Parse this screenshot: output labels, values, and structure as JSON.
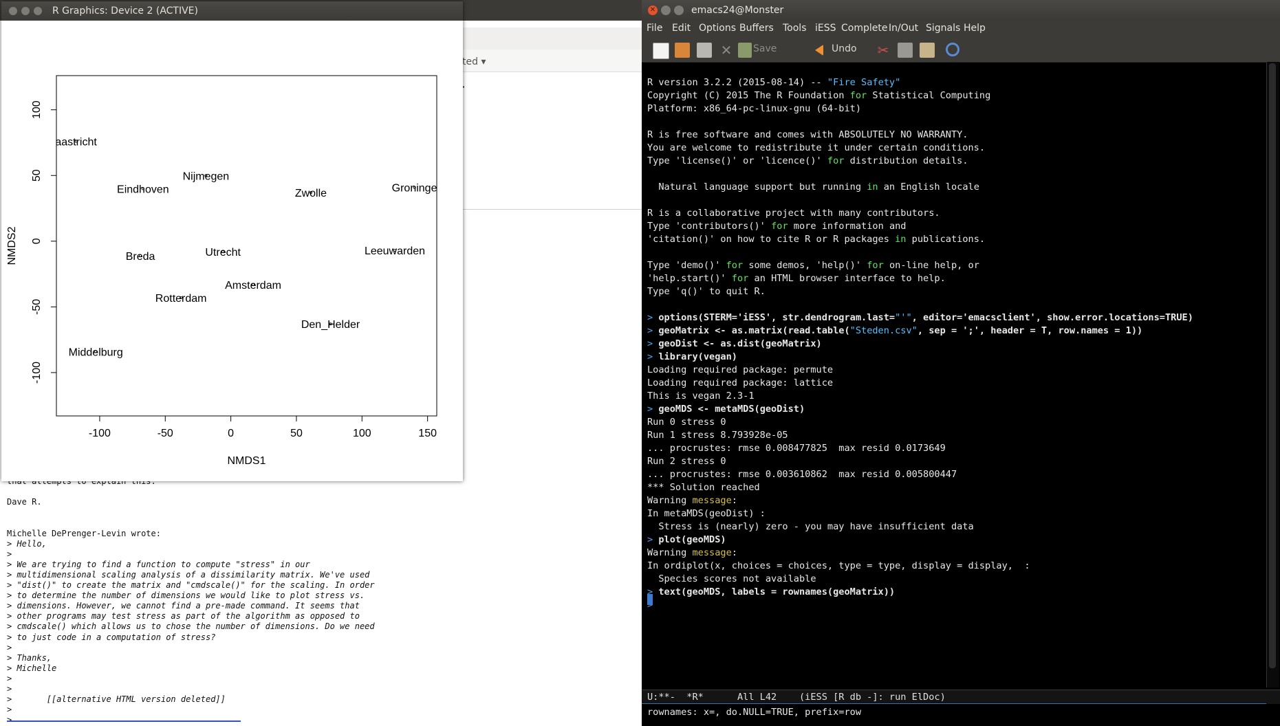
{
  "background_window": {
    "tab_partial": "ted ▾",
    "heading_partial": ".g",
    "email_lines": [
      "that attempts to explain this.",
      "",
      "Dave R.",
      "",
      "",
      "Michelle DePrenger-Levin wrote:",
      "> Hello,",
      ">",
      "> We are trying to find a function to compute \"stress\" in our",
      "> multidimensional scaling analysis of a dissimilarity matrix. We've used",
      "> \"dist()\" to create the matrix and \"cmdscale()\" for the scaling. In order",
      "> to determine the number of dimensions we would like to plot stress vs.",
      "> dimensions. However, we cannot find a pre-made command. It seems that",
      "> other programs may test stress as part of the algorithm as opposed to",
      "> cmdscale() which allows us to chose the number of dimensions. Do we need",
      "> to just code in a computation of stress?",
      ">",
      "> Thanks,",
      "> Michelle",
      ">",
      ">",
      ">       [[alternative HTML version deleted]]",
      ">",
      ">"
    ]
  },
  "r_graphics": {
    "title": "R Graphics: Device 2 (ACTIVE)",
    "chart_data": {
      "type": "scatter",
      "xlabel": "NMDS1",
      "ylabel": "NMDS2",
      "xlim": [
        -133,
        157
      ],
      "ylim": [
        -133,
        126
      ],
      "x_ticks": [
        -100,
        -50,
        0,
        50,
        100,
        150
      ],
      "y_ticks": [
        -100,
        -50,
        0,
        50,
        100
      ],
      "points": [
        {
          "label": "aastricht",
          "x": -118,
          "y": 76
        },
        {
          "label": "Nijmegen",
          "x": -19,
          "y": 50
        },
        {
          "label": "Eindhoven",
          "x": -67,
          "y": 40
        },
        {
          "label": "Zwolle",
          "x": 61,
          "y": 37
        },
        {
          "label": "Groninge",
          "x": 140,
          "y": 41
        },
        {
          "label": "Breda",
          "x": -69,
          "y": -11
        },
        {
          "label": "Utrecht",
          "x": -6,
          "y": -8
        },
        {
          "label": "Leeuwarden",
          "x": 125,
          "y": -7
        },
        {
          "label": "Amsterdam",
          "x": 17,
          "y": -33
        },
        {
          "label": "Rotterdam",
          "x": -38,
          "y": -43
        },
        {
          "label": "Den_Helder",
          "x": 76,
          "y": -63
        },
        {
          "label": "Middelburg",
          "x": -103,
          "y": -84
        }
      ]
    }
  },
  "emacs": {
    "title": "emacs24@Monster",
    "menu": [
      "File",
      "Edit",
      "Options",
      "Buffers",
      "Tools",
      "iESS",
      "Complete",
      "In/Out",
      "Signals",
      "Help"
    ],
    "toolbar": {
      "save_label": "Save",
      "undo_label": "Undo"
    },
    "lines": [
      [
        {
          "t": "R version 3.2.2 (2015-08-14) -- "
        },
        {
          "t": "\"Fire Safety\"",
          "c": "str"
        }
      ],
      [
        {
          "t": "Copyright (C) 2015 The R Foundation "
        },
        {
          "t": "for",
          "c": "kw"
        },
        {
          "t": " Statistical Computing"
        }
      ],
      [
        {
          "t": "Platform: x86_64-pc-linux-gnu (64-bit)"
        }
      ],
      [],
      [
        {
          "t": "R is free software and comes with ABSOLUTELY NO WARRANTY."
        }
      ],
      [
        {
          "t": "You are welcome to redistribute it under certain conditions."
        }
      ],
      [
        {
          "t": "Type 'license()' or 'licence()' "
        },
        {
          "t": "for",
          "c": "kw"
        },
        {
          "t": " distribution details."
        }
      ],
      [],
      [
        {
          "t": "  Natural language support but running "
        },
        {
          "t": "in",
          "c": "kw"
        },
        {
          "t": " an English locale"
        }
      ],
      [],
      [
        {
          "t": "R is a collaborative project with many contributors."
        }
      ],
      [
        {
          "t": "Type 'contributors()' "
        },
        {
          "t": "for",
          "c": "kw"
        },
        {
          "t": " more information and"
        }
      ],
      [
        {
          "t": "'citation()' on how to cite R or R packages "
        },
        {
          "t": "in",
          "c": "kw"
        },
        {
          "t": " publications."
        }
      ],
      [],
      [
        {
          "t": "Type 'demo()' "
        },
        {
          "t": "for",
          "c": "kw"
        },
        {
          "t": " some demos, 'help()' "
        },
        {
          "t": "for",
          "c": "kw"
        },
        {
          "t": " on-line help, or"
        }
      ],
      [
        {
          "t": "'help.start()' "
        },
        {
          "t": "for",
          "c": "kw"
        },
        {
          "t": " an HTML browser interface to help."
        }
      ],
      [
        {
          "t": "Type 'q()' to quit R."
        }
      ],
      [],
      [
        {
          "t": "> ",
          "c": "prompt"
        },
        {
          "t": "options(STERM='iESS', str.dendrogram.last=",
          "c": "b"
        },
        {
          "t": "\"'\"",
          "c": "str"
        },
        {
          "t": ", editor='emacsclient', show.error.locations=TRUE)",
          "c": "b"
        }
      ],
      [
        {
          "t": "> ",
          "c": "prompt"
        },
        {
          "t": "geoMatrix <- as.matrix(read.table(",
          "c": "b"
        },
        {
          "t": "\"Steden.csv\"",
          "c": "str"
        },
        {
          "t": ", sep = ';', header = T, row.names = 1))",
          "c": "b"
        }
      ],
      [
        {
          "t": "> ",
          "c": "prompt"
        },
        {
          "t": "geoDist <- as.dist(geoMatrix)",
          "c": "b"
        }
      ],
      [
        {
          "t": "> ",
          "c": "prompt"
        },
        {
          "t": "library(vegan)",
          "c": "b"
        }
      ],
      [
        {
          "t": "Loading required package: permute"
        }
      ],
      [
        {
          "t": "Loading required package: lattice"
        }
      ],
      [
        {
          "t": "This is vegan 2.3-1"
        }
      ],
      [
        {
          "t": "> ",
          "c": "prompt"
        },
        {
          "t": "geoMDS <- metaMDS(geoDist)",
          "c": "b"
        }
      ],
      [
        {
          "t": "Run 0 stress 0"
        }
      ],
      [
        {
          "t": "Run 1 stress 8.793928e-05"
        }
      ],
      [
        {
          "t": "... procrustes: rmse 0.008477825  max resid 0.0173649"
        }
      ],
      [
        {
          "t": "Run 2 stress 0"
        }
      ],
      [
        {
          "t": "... procrustes: rmse 0.003610862  max resid 0.005800447"
        }
      ],
      [
        {
          "t": "*** Solution reached"
        }
      ],
      [
        {
          "t": "Warning "
        },
        {
          "t": "message",
          "c": "warn"
        },
        {
          "t": ":"
        }
      ],
      [
        {
          "t": "In metaMDS(geoDist) :"
        }
      ],
      [
        {
          "t": "  Stress is (nearly) zero - you may have insufficient data"
        }
      ],
      [
        {
          "t": "> ",
          "c": "prompt"
        },
        {
          "t": "plot(geoMDS)",
          "c": "b"
        }
      ],
      [
        {
          "t": "Warning "
        },
        {
          "t": "message",
          "c": "warn"
        },
        {
          "t": ":"
        }
      ],
      [
        {
          "t": "In ordiplot(x, choices = choices, type = type, display = display,  :"
        }
      ],
      [
        {
          "t": "  Species scores not available"
        }
      ],
      [
        {
          "t": "> ",
          "c": "prompt"
        },
        {
          "t": "text(geoMDS, labels = rownames(geoMatrix))",
          "c": "b"
        }
      ],
      [
        {
          "t": "> ",
          "c": "prompt"
        }
      ]
    ],
    "modeline": "U:**-  *R*      All L42    (iESS [R db -]: run ElDoc)",
    "minibuffer": "rownames: x=, do.NULL=TRUE, prefix=row"
  }
}
